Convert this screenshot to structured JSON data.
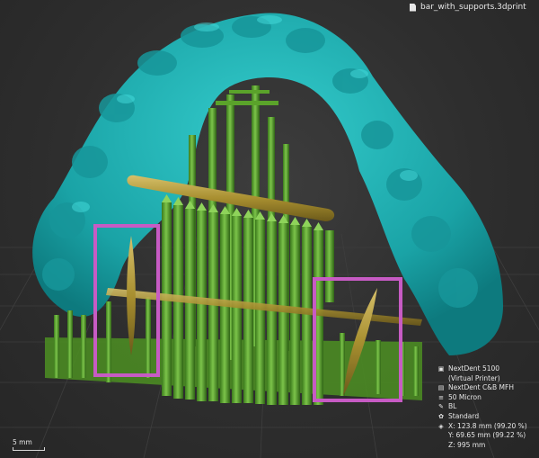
{
  "file": {
    "name": "bar_with_supports.3dprint",
    "icon": "file-icon"
  },
  "printer_info": [
    {
      "icon": "printer-icon",
      "text": "NextDent 5100"
    },
    {
      "icon": "",
      "text": "(Virtual Printer)"
    },
    {
      "icon": "material-icon",
      "text": "NextDent C&B MFH"
    },
    {
      "icon": "layer-icon",
      "text": "50 Micron"
    },
    {
      "icon": "wrench-icon",
      "text": "BL"
    },
    {
      "icon": "gear-icon",
      "text": "Standard"
    }
  ],
  "dimensions": {
    "icon": "dimensions-icon",
    "x": "X: 123.8 mm (99.20 %)",
    "y": "Y: 69.65 mm (99.22 %)",
    "z": "Z: 995 mm"
  },
  "scale_label": "5 mm",
  "colors": {
    "model": "#1fb3b3",
    "supports": "#5aa32a",
    "bar": "#b09a3a",
    "highlight_box": "#c75bc4",
    "background": "#2e2e2e",
    "grid": "#3a3a3a"
  }
}
